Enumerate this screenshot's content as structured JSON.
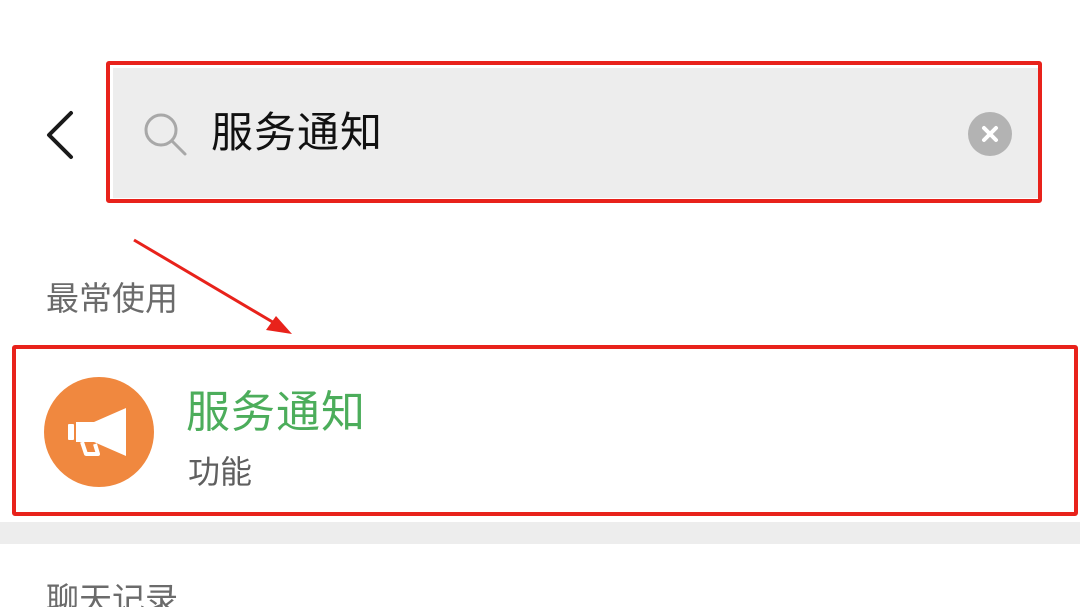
{
  "search": {
    "query": "服务通知"
  },
  "sections": {
    "frequent_label": "最常使用",
    "chat_label": "聊天记录"
  },
  "result": {
    "title": "服务通知",
    "subtitle": "功能"
  },
  "colors": {
    "highlight": "#e8221b",
    "accent_green": "#4cad5b",
    "avatar_orange": "#f0883f",
    "search_bg": "#ededed"
  },
  "icons": {
    "back": "chevron-left-icon",
    "search": "search-icon",
    "clear": "clear-icon",
    "avatar": "megaphone-icon",
    "annotation": "arrow-icon"
  }
}
